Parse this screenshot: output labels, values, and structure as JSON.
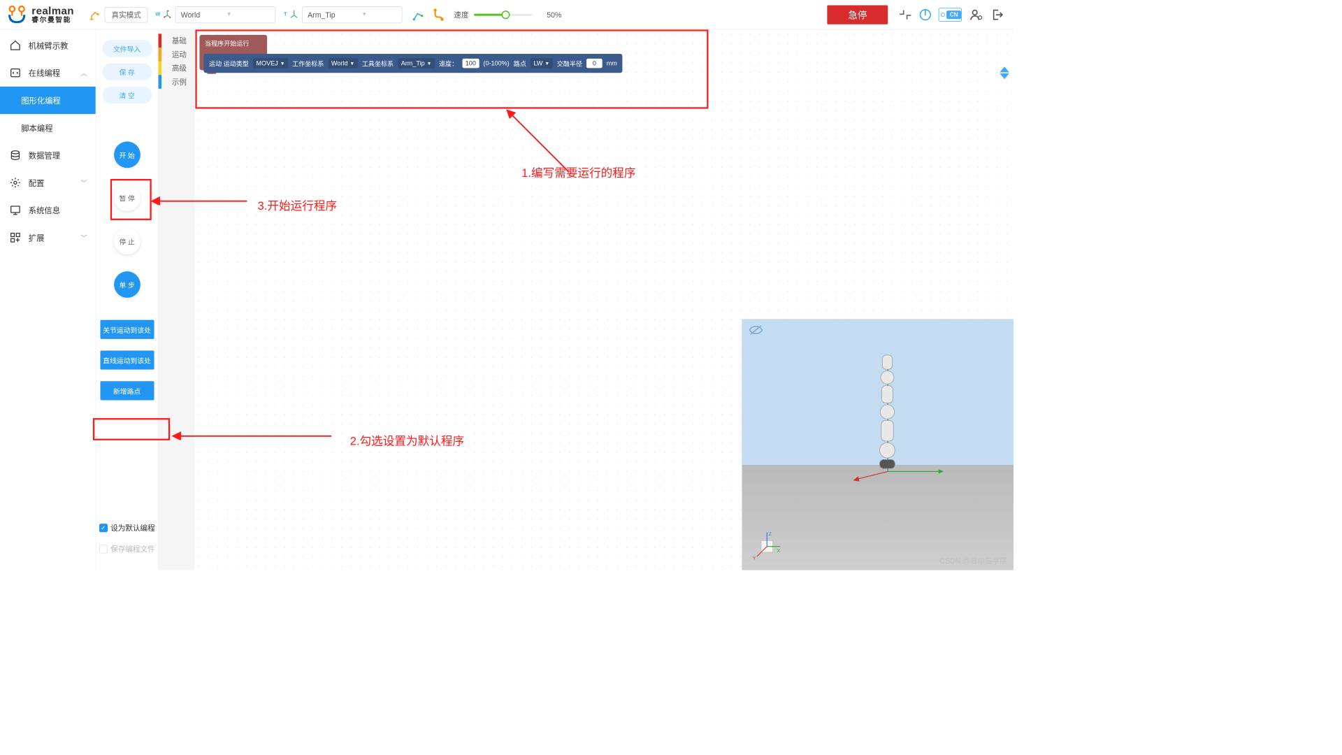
{
  "brand": {
    "en": "realman",
    "zh": "睿尔曼智能"
  },
  "header": {
    "mode": "真实模式",
    "world_select": "World",
    "tool_select": "Arm_Tip",
    "speed_label": "速度",
    "speed_value": "50%",
    "estop": "急停",
    "lang": "CN",
    "axis_w": "W",
    "axis_t": "T"
  },
  "sidebar": {
    "items": [
      {
        "label": "机械臂示教"
      },
      {
        "label": "在线编程"
      },
      {
        "label": "图形化编程"
      },
      {
        "label": "脚本编程"
      },
      {
        "label": "数据管理"
      },
      {
        "label": "配置"
      },
      {
        "label": "系统信息"
      },
      {
        "label": "扩展"
      }
    ]
  },
  "toolcol": {
    "import": "文件导入",
    "save": "保 存",
    "clear": "清 空",
    "start": "开 始",
    "pause": "暂 停",
    "stop": "停 止",
    "step": "单 步",
    "joint_move": "关节运动到该处",
    "line_move": "直线运动到该处",
    "add_point": "新增路点",
    "check_default": "设为默认编程",
    "check_save": "保存编程文件"
  },
  "categories": [
    "基础",
    "运动",
    "高级",
    "示例"
  ],
  "cat_colors": [
    "#d82c2c",
    "#f5a623",
    "#f5d327",
    "#2196f3"
  ],
  "block": {
    "start_label": "当程序开始运行",
    "motion": "运动 运动类型",
    "movej": "MOVEJ",
    "work_frame": "工作坐标系",
    "world": "World",
    "tool_frame": "工具坐标系",
    "arm_tip": "Arm_Tip",
    "speed": "速度：",
    "speed_val": "100",
    "speed_range": "(0-100%)",
    "point": "路点",
    "lw": "LW",
    "radius": "交融半径",
    "radius_val": "0",
    "mm": "mm"
  },
  "annotations": {
    "a1": "1.编写需要运行的程序",
    "a2": "2.勾选设置为默认程序",
    "a3": "3.开始运行程序"
  },
  "preview": {
    "axes": {
      "x": "X",
      "y": "Y",
      "z": "Z"
    }
  },
  "watermark": "CSDN @睿尔曼学院"
}
